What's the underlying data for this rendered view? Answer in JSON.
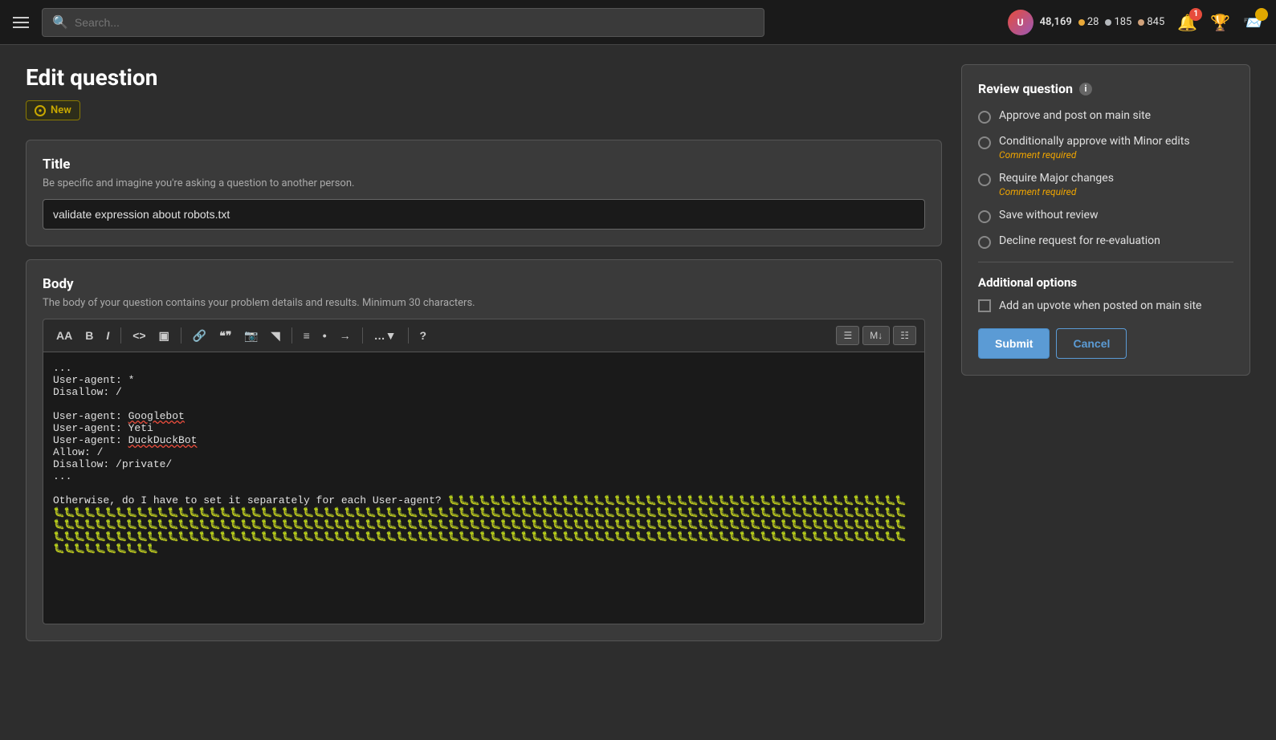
{
  "header": {
    "search_placeholder": "Search...",
    "reputation": "48,169",
    "gold_count": "28",
    "silver_count": "185",
    "bronze_count": "845",
    "notification_count": "1",
    "avatar_initials": "U"
  },
  "page": {
    "title": "Edit question",
    "new_badge_label": "New"
  },
  "title_section": {
    "label": "Title",
    "hint": "Be specific and imagine you're asking a question to another person.",
    "value": "validate expression about robots.txt"
  },
  "body_section": {
    "label": "Body",
    "hint": "The body of your question contains your problem details and results. Minimum 30 characters.",
    "content_line1": "...",
    "content_line2": "User-agent: *",
    "content_line3": "Disallow: /",
    "content_line4": "",
    "content_line5": "User-agent: Googlebot",
    "content_line6": "User-agent: Yeti",
    "content_line7": "User-agent: DuckDuckBot",
    "content_line8": "Allow: /",
    "content_line9": "Disallow: /private/",
    "content_line10": "...",
    "content_question": "Otherwise, do I have to set it separately for each User-agent?"
  },
  "toolbar": {
    "buttons": [
      "AA",
      "B",
      "I",
      "<>",
      "⬛",
      "🔗",
      "\"\"",
      "🖼",
      "⊞",
      "≡",
      "⊙",
      "≡",
      "…",
      "?"
    ],
    "view_btns": [
      "≡",
      "M↓",
      "⊞"
    ]
  },
  "review": {
    "title": "Review question",
    "options": [
      {
        "id": "approve",
        "label": "Approve and post on main site",
        "subnote": null
      },
      {
        "id": "conditional",
        "label": "Conditionally approve with Minor edits",
        "subnote": "Comment required"
      },
      {
        "id": "major",
        "label": "Require Major changes",
        "subnote": "Comment required"
      },
      {
        "id": "save_no_review",
        "label": "Save without review",
        "subnote": null
      },
      {
        "id": "decline",
        "label": "Decline request for re-evaluation",
        "subnote": null
      }
    ],
    "additional_title": "Additional options",
    "additional_options": [
      {
        "id": "upvote",
        "label": "Add an upvote when posted on main site"
      }
    ],
    "submit_label": "Submit",
    "cancel_label": "Cancel"
  }
}
